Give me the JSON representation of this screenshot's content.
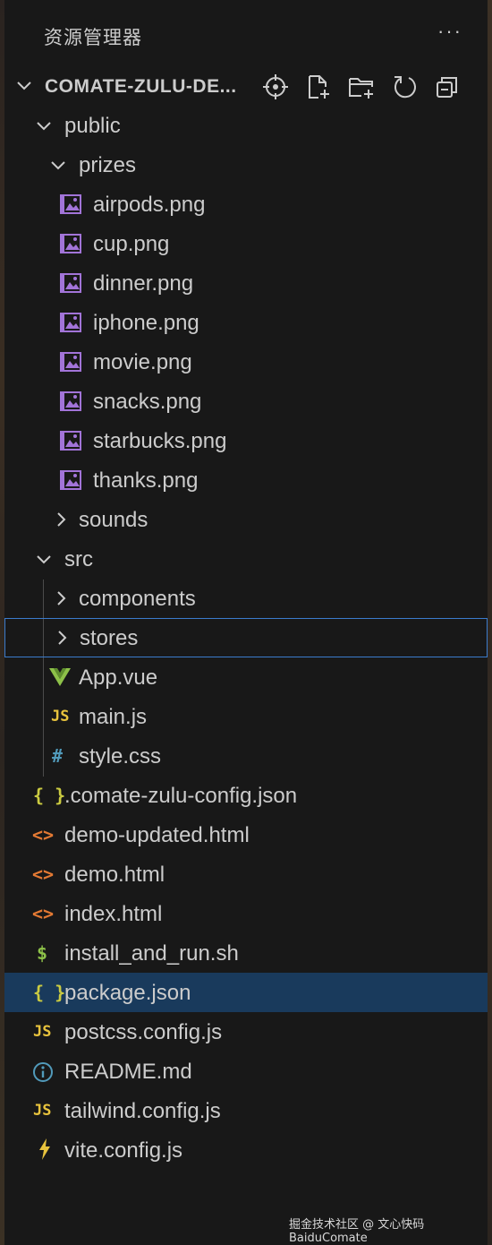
{
  "explorer": {
    "title": "资源管理器",
    "more_label": "···",
    "root_label": "COMATE-ZULU-DE...",
    "actions": [
      "crosshair-icon",
      "new-file-icon",
      "new-folder-icon",
      "refresh-icon",
      "collapse-all-icon"
    ]
  },
  "tree": {
    "public": "public",
    "prizes": "prizes",
    "prize_files": [
      "airpods.png",
      "cup.png",
      "dinner.png",
      "iphone.png",
      "movie.png",
      "snacks.png",
      "starbucks.png",
      "thanks.png"
    ],
    "sounds": "sounds",
    "src": "src",
    "components": "components",
    "stores": "stores",
    "app_vue": "App.vue",
    "main_js": "main.js",
    "style_css": "style.css",
    "root_files": [
      ".comate-zulu-config.json",
      "demo-updated.html",
      "demo.html",
      "index.html",
      "install_and_run.sh",
      "package.json",
      "postcss.config.js",
      "README.md",
      "tailwind.config.js",
      "vite.config.js"
    ]
  },
  "icons": {
    "js_text": "JS",
    "json_text": "{ }",
    "html_text": "<>",
    "css_text": "#",
    "sh_text": "$"
  },
  "colors": {
    "image_icon": "#a274d8",
    "js_icon": "#e8c33d",
    "json_icon": "#cbcb41",
    "html_icon": "#e37933",
    "css_icon": "#519aba",
    "vue_icon": "#8dc149",
    "selection": "#193a5c",
    "focus_border": "#3b7bcc"
  },
  "watermark": "掘金技术社区 @ 文心快码BaiduComate"
}
